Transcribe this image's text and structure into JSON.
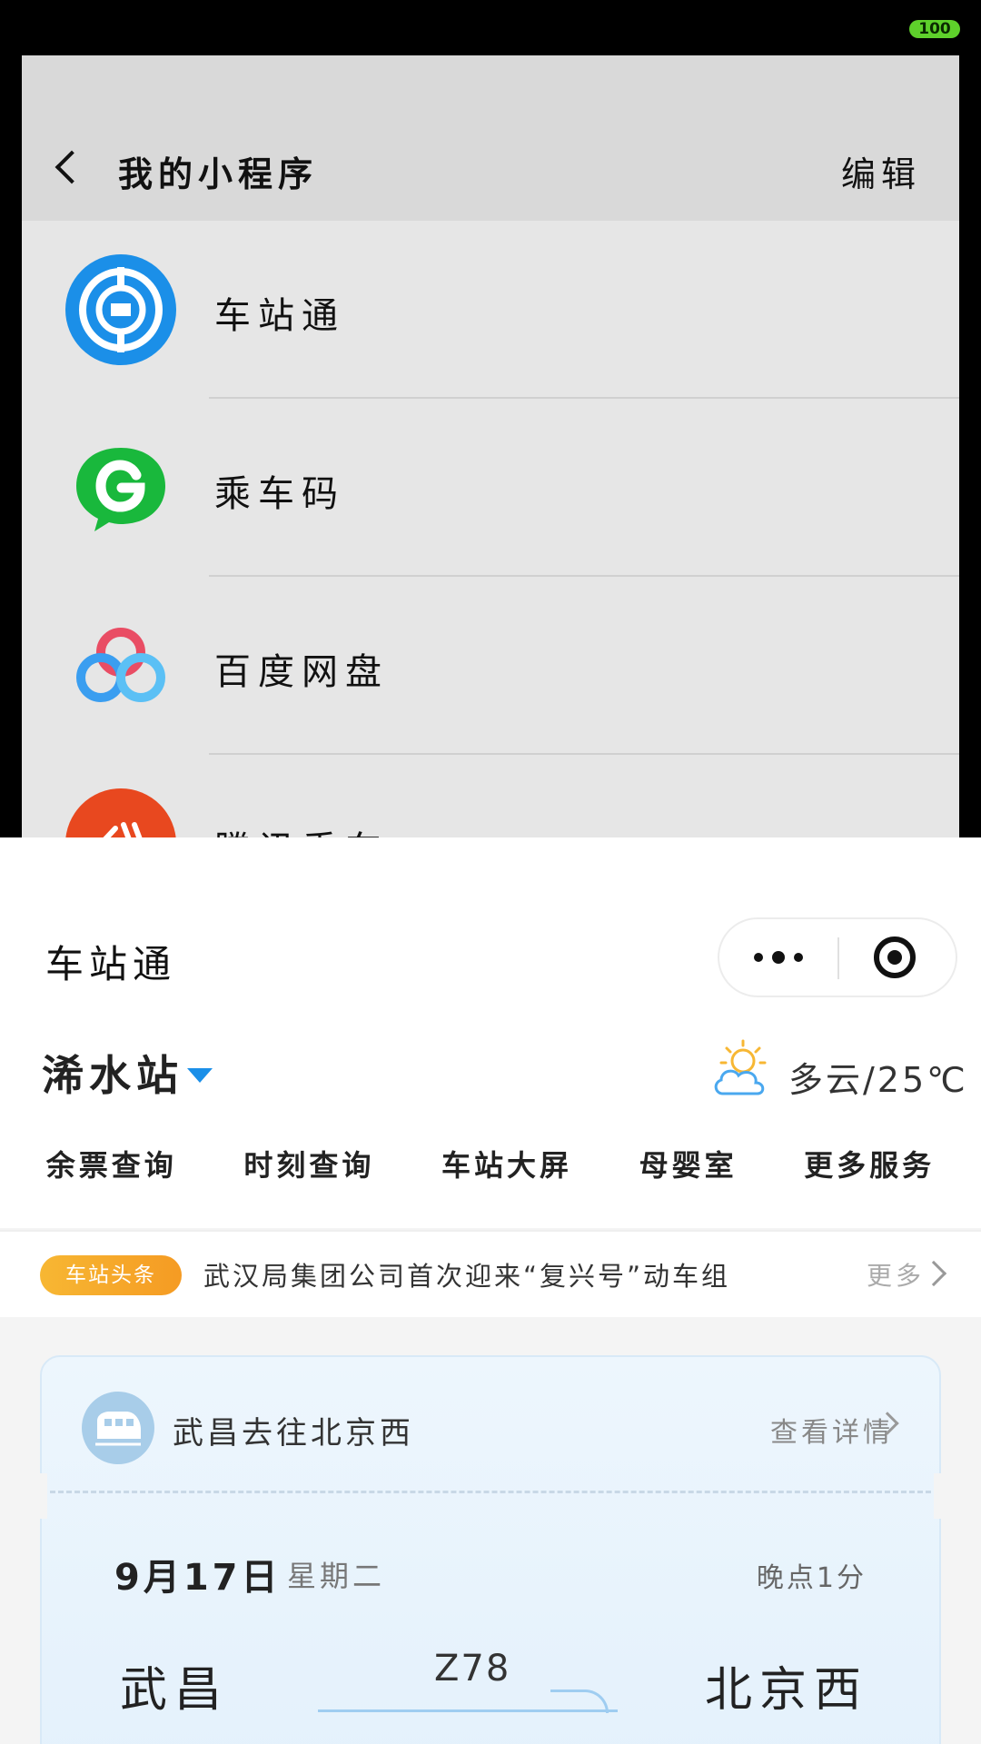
{
  "status_bar": {
    "battery": "100"
  },
  "mini_programs": {
    "title": "我的小程序",
    "edit_label": "编辑",
    "items": [
      {
        "label": "车站通",
        "icon": "station-icon"
      },
      {
        "label": "乘车码",
        "icon": "ride-code-icon"
      },
      {
        "label": "百度网盘",
        "icon": "baidu-netdisk-icon"
      },
      {
        "label": "腾讯乘车",
        "icon": "bus-app-icon"
      }
    ]
  },
  "app": {
    "title": "车站通",
    "station": "浠水站",
    "weather": "多云/25℃",
    "services": [
      "余票查询",
      "时刻查询",
      "车站大屏",
      "母婴室",
      "更多服务"
    ],
    "news": {
      "badge": "车站头条",
      "headline": "武汉局集团公司首次迎来“复兴号”动车组",
      "more": "更多"
    },
    "trip": {
      "route": "武昌去往北京西",
      "detail": "查看详情",
      "date": "9月17日",
      "weekday": "星期二",
      "delay": "晚点1分",
      "from": "武昌",
      "to": "北京西",
      "train_no": "Z78"
    }
  },
  "colors": {
    "accent_blue": "#1b8fe8",
    "badge_orange": "#f5a623",
    "battery_green": "#5ed12b"
  }
}
